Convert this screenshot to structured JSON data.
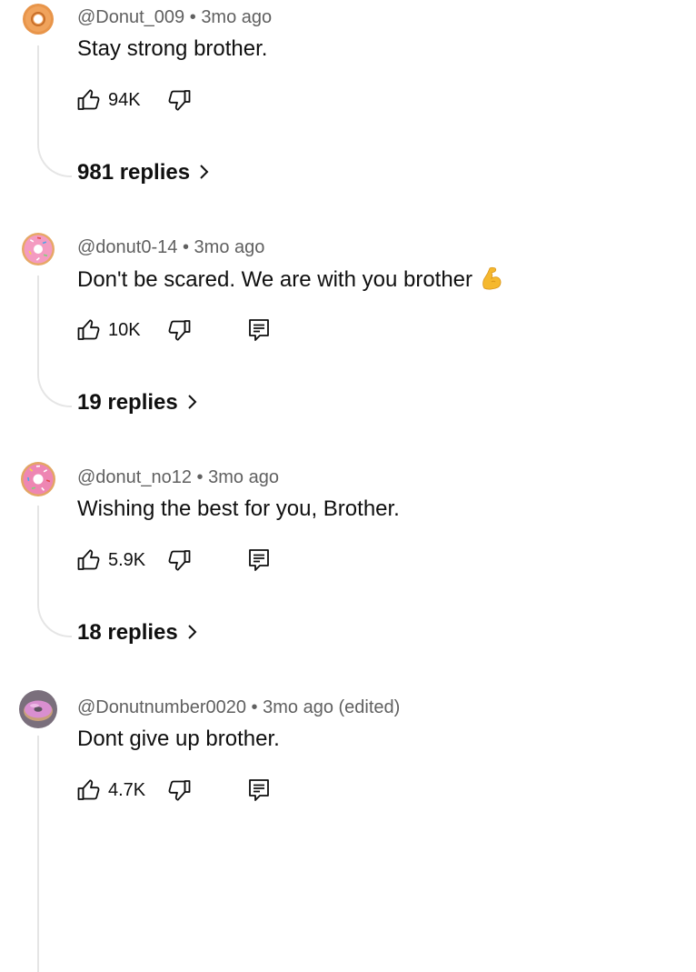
{
  "comments": [
    {
      "handle": "@Donut_009",
      "time": "3mo ago",
      "text": "Stay strong brother.",
      "likes": "94K",
      "replies": "981 replies",
      "avatar_color": "#e89a4d",
      "has_reply_button": false,
      "emoji": ""
    },
    {
      "handle": "@donut0-14",
      "time": "3mo ago",
      "text": "Don't be scared. We are with you brother",
      "likes": "10K",
      "replies": "19 replies",
      "avatar_color": "#f29bc0",
      "has_reply_button": true,
      "emoji": "flexed-biceps"
    },
    {
      "handle": "@donut_no12",
      "time": "3mo ago",
      "text": "Wishing the best for you, Brother.",
      "likes": "5.9K",
      "replies": "18 replies",
      "avatar_color": "#ee86b3",
      "has_reply_button": true,
      "emoji": ""
    },
    {
      "handle": "@Donutnumber0020",
      "time": "3mo ago (edited)",
      "text": "Dont give up brother.",
      "likes": "4.7K",
      "replies": "",
      "avatar_color": "#d98fd0",
      "has_reply_button": true,
      "emoji": ""
    }
  ],
  "separator": "•"
}
